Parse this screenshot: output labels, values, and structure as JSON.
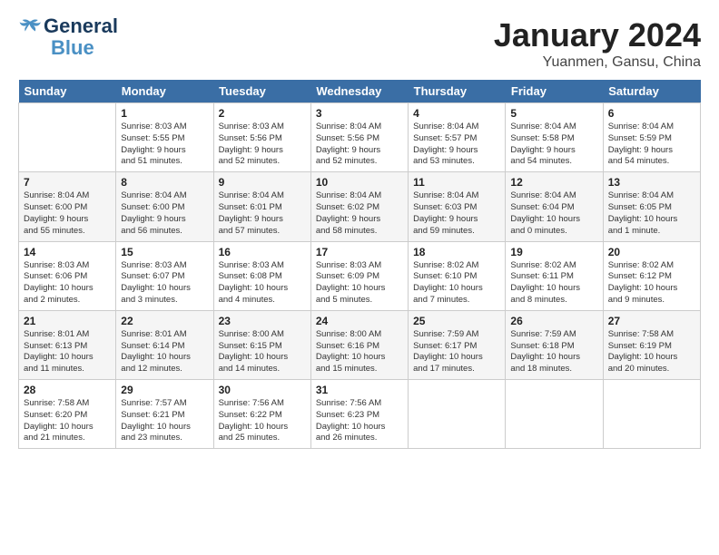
{
  "header": {
    "logo_line1": "General",
    "logo_line2": "Blue",
    "title": "January 2024",
    "subtitle": "Yuanmen, Gansu, China"
  },
  "days_of_week": [
    "Sunday",
    "Monday",
    "Tuesday",
    "Wednesday",
    "Thursday",
    "Friday",
    "Saturday"
  ],
  "weeks": [
    [
      {
        "day": "",
        "content": ""
      },
      {
        "day": "1",
        "content": "Sunrise: 8:03 AM\nSunset: 5:55 PM\nDaylight: 9 hours\nand 51 minutes."
      },
      {
        "day": "2",
        "content": "Sunrise: 8:03 AM\nSunset: 5:56 PM\nDaylight: 9 hours\nand 52 minutes."
      },
      {
        "day": "3",
        "content": "Sunrise: 8:04 AM\nSunset: 5:56 PM\nDaylight: 9 hours\nand 52 minutes."
      },
      {
        "day": "4",
        "content": "Sunrise: 8:04 AM\nSunset: 5:57 PM\nDaylight: 9 hours\nand 53 minutes."
      },
      {
        "day": "5",
        "content": "Sunrise: 8:04 AM\nSunset: 5:58 PM\nDaylight: 9 hours\nand 54 minutes."
      },
      {
        "day": "6",
        "content": "Sunrise: 8:04 AM\nSunset: 5:59 PM\nDaylight: 9 hours\nand 54 minutes."
      }
    ],
    [
      {
        "day": "7",
        "content": "Sunrise: 8:04 AM\nSunset: 6:00 PM\nDaylight: 9 hours\nand 55 minutes."
      },
      {
        "day": "8",
        "content": "Sunrise: 8:04 AM\nSunset: 6:00 PM\nDaylight: 9 hours\nand 56 minutes."
      },
      {
        "day": "9",
        "content": "Sunrise: 8:04 AM\nSunset: 6:01 PM\nDaylight: 9 hours\nand 57 minutes."
      },
      {
        "day": "10",
        "content": "Sunrise: 8:04 AM\nSunset: 6:02 PM\nDaylight: 9 hours\nand 58 minutes."
      },
      {
        "day": "11",
        "content": "Sunrise: 8:04 AM\nSunset: 6:03 PM\nDaylight: 9 hours\nand 59 minutes."
      },
      {
        "day": "12",
        "content": "Sunrise: 8:04 AM\nSunset: 6:04 PM\nDaylight: 10 hours\nand 0 minutes."
      },
      {
        "day": "13",
        "content": "Sunrise: 8:04 AM\nSunset: 6:05 PM\nDaylight: 10 hours\nand 1 minute."
      }
    ],
    [
      {
        "day": "14",
        "content": "Sunrise: 8:03 AM\nSunset: 6:06 PM\nDaylight: 10 hours\nand 2 minutes."
      },
      {
        "day": "15",
        "content": "Sunrise: 8:03 AM\nSunset: 6:07 PM\nDaylight: 10 hours\nand 3 minutes."
      },
      {
        "day": "16",
        "content": "Sunrise: 8:03 AM\nSunset: 6:08 PM\nDaylight: 10 hours\nand 4 minutes."
      },
      {
        "day": "17",
        "content": "Sunrise: 8:03 AM\nSunset: 6:09 PM\nDaylight: 10 hours\nand 5 minutes."
      },
      {
        "day": "18",
        "content": "Sunrise: 8:02 AM\nSunset: 6:10 PM\nDaylight: 10 hours\nand 7 minutes."
      },
      {
        "day": "19",
        "content": "Sunrise: 8:02 AM\nSunset: 6:11 PM\nDaylight: 10 hours\nand 8 minutes."
      },
      {
        "day": "20",
        "content": "Sunrise: 8:02 AM\nSunset: 6:12 PM\nDaylight: 10 hours\nand 9 minutes."
      }
    ],
    [
      {
        "day": "21",
        "content": "Sunrise: 8:01 AM\nSunset: 6:13 PM\nDaylight: 10 hours\nand 11 minutes."
      },
      {
        "day": "22",
        "content": "Sunrise: 8:01 AM\nSunset: 6:14 PM\nDaylight: 10 hours\nand 12 minutes."
      },
      {
        "day": "23",
        "content": "Sunrise: 8:00 AM\nSunset: 6:15 PM\nDaylight: 10 hours\nand 14 minutes."
      },
      {
        "day": "24",
        "content": "Sunrise: 8:00 AM\nSunset: 6:16 PM\nDaylight: 10 hours\nand 15 minutes."
      },
      {
        "day": "25",
        "content": "Sunrise: 7:59 AM\nSunset: 6:17 PM\nDaylight: 10 hours\nand 17 minutes."
      },
      {
        "day": "26",
        "content": "Sunrise: 7:59 AM\nSunset: 6:18 PM\nDaylight: 10 hours\nand 18 minutes."
      },
      {
        "day": "27",
        "content": "Sunrise: 7:58 AM\nSunset: 6:19 PM\nDaylight: 10 hours\nand 20 minutes."
      }
    ],
    [
      {
        "day": "28",
        "content": "Sunrise: 7:58 AM\nSunset: 6:20 PM\nDaylight: 10 hours\nand 21 minutes."
      },
      {
        "day": "29",
        "content": "Sunrise: 7:57 AM\nSunset: 6:21 PM\nDaylight: 10 hours\nand 23 minutes."
      },
      {
        "day": "30",
        "content": "Sunrise: 7:56 AM\nSunset: 6:22 PM\nDaylight: 10 hours\nand 25 minutes."
      },
      {
        "day": "31",
        "content": "Sunrise: 7:56 AM\nSunset: 6:23 PM\nDaylight: 10 hours\nand 26 minutes."
      },
      {
        "day": "",
        "content": ""
      },
      {
        "day": "",
        "content": ""
      },
      {
        "day": "",
        "content": ""
      }
    ]
  ]
}
